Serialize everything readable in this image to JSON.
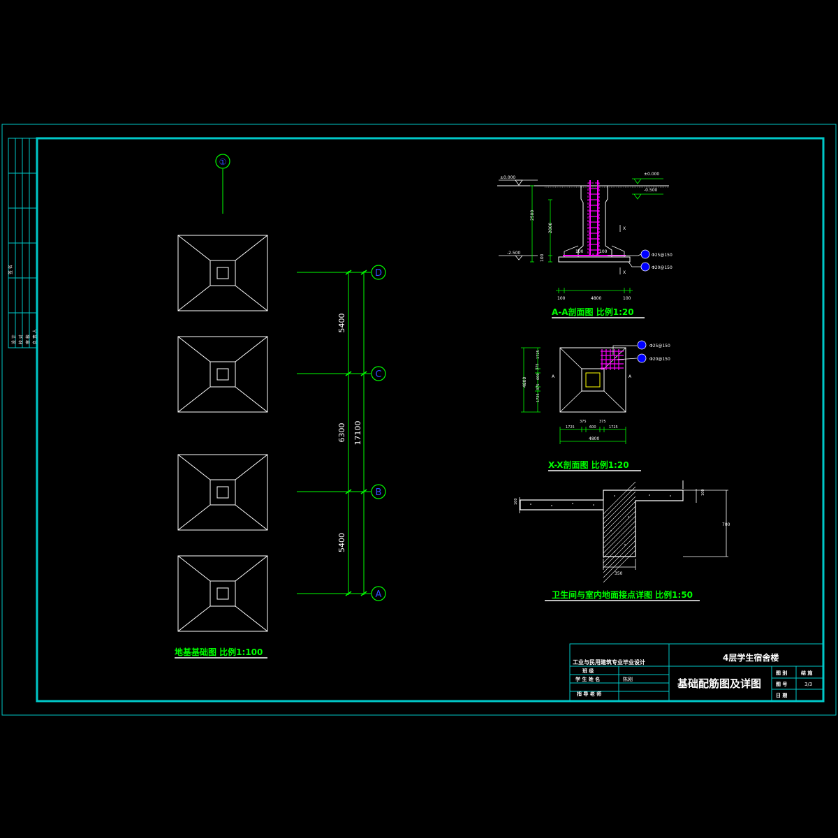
{
  "colors": {
    "background": "#000000",
    "frame": "#00c8c8",
    "line": "#ffffff",
    "axis": "#00ff00",
    "bubble": "#0000ff",
    "rebar": "#ff00ff",
    "yellow": "#ffff00",
    "title": "#00ff00"
  },
  "grid": {
    "top_bubble": "①",
    "bubbles": [
      "D",
      "C",
      "B",
      "A"
    ],
    "dims": [
      "5400",
      "6300",
      "5400"
    ],
    "total": "17100"
  },
  "plan": {
    "title": "地基基础图   比例1:100"
  },
  "section_aa": {
    "title": "A-A剖面图   比例1:20",
    "elev_top": "±0.000",
    "elev_right_top": "±0.000",
    "elev_right_bot": "-0.500",
    "elev_bottom": "-2.500",
    "dim_h_total": "2500",
    "dim_h_col": "2000",
    "dim_h_base": "100",
    "step_left": "100",
    "step_right": "100",
    "bot_left": "100",
    "bot_mid": "4800",
    "bot_right": "100",
    "rebar1": "Φ25@150",
    "rebar2": "Φ20@150",
    "cut_mark": "X"
  },
  "section_xx": {
    "title": "X-X剖面图   比例1:20",
    "rebar1": "Φ25@150",
    "rebar2": "Φ20@150",
    "side_total": "4800",
    "side_parts": [
      "1725",
      "375",
      "600",
      "375",
      "1725"
    ],
    "top_parts": [
      "375",
      "600",
      "375"
    ],
    "bot_parts": [
      "1725",
      "1725"
    ],
    "bot_total": "4800",
    "cut_mark": "A"
  },
  "detail": {
    "title": "卫生间与室内地面接点详图   比例1:50",
    "left_dim": "100",
    "right_dim": "100",
    "height": "700",
    "width": "350"
  },
  "titleblock": {
    "school": "工业与民用建筑专业毕业设计",
    "row1": "班  级",
    "row2": "学 生 姓 名",
    "row2_value": "陈刚",
    "row3": "指 导 老 师",
    "project": "4层学生宿舍楼",
    "drawing": "基础配筋图及详图",
    "k1": "图 别",
    "v1": "结 施",
    "k2": "图 号",
    "v2": "3/3",
    "k3": "日 期"
  },
  "sidebar": {
    "note1": "签 名",
    "notes": [
      "设 计",
      "校 对",
      "审 核",
      "负 责 人"
    ]
  }
}
